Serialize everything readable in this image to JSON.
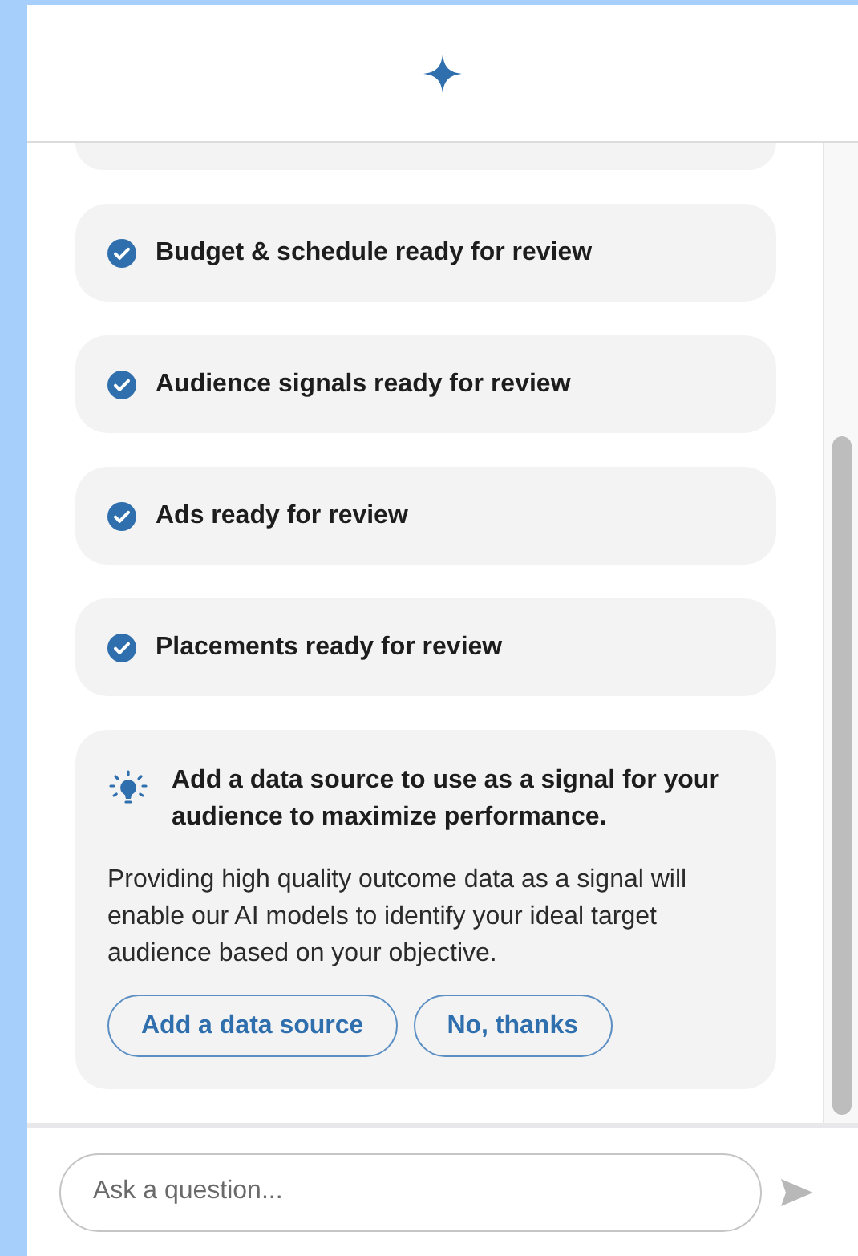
{
  "status_items": [
    {
      "label": "Budget & schedule ready for review"
    },
    {
      "label": "Audience signals ready for review"
    },
    {
      "label": "Ads ready for review"
    },
    {
      "label": "Placements ready for review"
    }
  ],
  "suggestion": {
    "title": "Add a data source to use as a signal for your audience to maximize performance.",
    "body": "Providing high quality outcome data as a signal will enable our AI models to identify your ideal target audience based on your objective.",
    "buttons": [
      "Add a data source",
      "No, thanks"
    ]
  },
  "composer": {
    "placeholder": "Ask a question..."
  }
}
